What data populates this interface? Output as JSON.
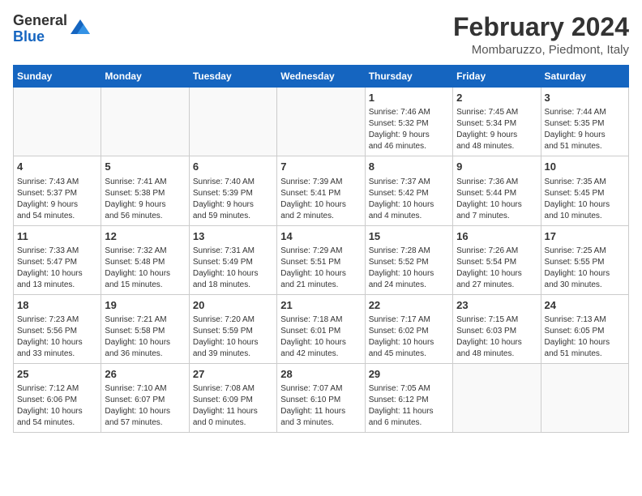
{
  "header": {
    "logo_general": "General",
    "logo_blue": "Blue",
    "title": "February 2024",
    "subtitle": "Mombaruzzo, Piedmont, Italy"
  },
  "days_of_week": [
    "Sunday",
    "Monday",
    "Tuesday",
    "Wednesday",
    "Thursday",
    "Friday",
    "Saturday"
  ],
  "weeks": [
    [
      {
        "day": "",
        "info": ""
      },
      {
        "day": "",
        "info": ""
      },
      {
        "day": "",
        "info": ""
      },
      {
        "day": "",
        "info": ""
      },
      {
        "day": "1",
        "info": "Sunrise: 7:46 AM\nSunset: 5:32 PM\nDaylight: 9 hours\nand 46 minutes."
      },
      {
        "day": "2",
        "info": "Sunrise: 7:45 AM\nSunset: 5:34 PM\nDaylight: 9 hours\nand 48 minutes."
      },
      {
        "day": "3",
        "info": "Sunrise: 7:44 AM\nSunset: 5:35 PM\nDaylight: 9 hours\nand 51 minutes."
      }
    ],
    [
      {
        "day": "4",
        "info": "Sunrise: 7:43 AM\nSunset: 5:37 PM\nDaylight: 9 hours\nand 54 minutes."
      },
      {
        "day": "5",
        "info": "Sunrise: 7:41 AM\nSunset: 5:38 PM\nDaylight: 9 hours\nand 56 minutes."
      },
      {
        "day": "6",
        "info": "Sunrise: 7:40 AM\nSunset: 5:39 PM\nDaylight: 9 hours\nand 59 minutes."
      },
      {
        "day": "7",
        "info": "Sunrise: 7:39 AM\nSunset: 5:41 PM\nDaylight: 10 hours\nand 2 minutes."
      },
      {
        "day": "8",
        "info": "Sunrise: 7:37 AM\nSunset: 5:42 PM\nDaylight: 10 hours\nand 4 minutes."
      },
      {
        "day": "9",
        "info": "Sunrise: 7:36 AM\nSunset: 5:44 PM\nDaylight: 10 hours\nand 7 minutes."
      },
      {
        "day": "10",
        "info": "Sunrise: 7:35 AM\nSunset: 5:45 PM\nDaylight: 10 hours\nand 10 minutes."
      }
    ],
    [
      {
        "day": "11",
        "info": "Sunrise: 7:33 AM\nSunset: 5:47 PM\nDaylight: 10 hours\nand 13 minutes."
      },
      {
        "day": "12",
        "info": "Sunrise: 7:32 AM\nSunset: 5:48 PM\nDaylight: 10 hours\nand 15 minutes."
      },
      {
        "day": "13",
        "info": "Sunrise: 7:31 AM\nSunset: 5:49 PM\nDaylight: 10 hours\nand 18 minutes."
      },
      {
        "day": "14",
        "info": "Sunrise: 7:29 AM\nSunset: 5:51 PM\nDaylight: 10 hours\nand 21 minutes."
      },
      {
        "day": "15",
        "info": "Sunrise: 7:28 AM\nSunset: 5:52 PM\nDaylight: 10 hours\nand 24 minutes."
      },
      {
        "day": "16",
        "info": "Sunrise: 7:26 AM\nSunset: 5:54 PM\nDaylight: 10 hours\nand 27 minutes."
      },
      {
        "day": "17",
        "info": "Sunrise: 7:25 AM\nSunset: 5:55 PM\nDaylight: 10 hours\nand 30 minutes."
      }
    ],
    [
      {
        "day": "18",
        "info": "Sunrise: 7:23 AM\nSunset: 5:56 PM\nDaylight: 10 hours\nand 33 minutes."
      },
      {
        "day": "19",
        "info": "Sunrise: 7:21 AM\nSunset: 5:58 PM\nDaylight: 10 hours\nand 36 minutes."
      },
      {
        "day": "20",
        "info": "Sunrise: 7:20 AM\nSunset: 5:59 PM\nDaylight: 10 hours\nand 39 minutes."
      },
      {
        "day": "21",
        "info": "Sunrise: 7:18 AM\nSunset: 6:01 PM\nDaylight: 10 hours\nand 42 minutes."
      },
      {
        "day": "22",
        "info": "Sunrise: 7:17 AM\nSunset: 6:02 PM\nDaylight: 10 hours\nand 45 minutes."
      },
      {
        "day": "23",
        "info": "Sunrise: 7:15 AM\nSunset: 6:03 PM\nDaylight: 10 hours\nand 48 minutes."
      },
      {
        "day": "24",
        "info": "Sunrise: 7:13 AM\nSunset: 6:05 PM\nDaylight: 10 hours\nand 51 minutes."
      }
    ],
    [
      {
        "day": "25",
        "info": "Sunrise: 7:12 AM\nSunset: 6:06 PM\nDaylight: 10 hours\nand 54 minutes."
      },
      {
        "day": "26",
        "info": "Sunrise: 7:10 AM\nSunset: 6:07 PM\nDaylight: 10 hours\nand 57 minutes."
      },
      {
        "day": "27",
        "info": "Sunrise: 7:08 AM\nSunset: 6:09 PM\nDaylight: 11 hours\nand 0 minutes."
      },
      {
        "day": "28",
        "info": "Sunrise: 7:07 AM\nSunset: 6:10 PM\nDaylight: 11 hours\nand 3 minutes."
      },
      {
        "day": "29",
        "info": "Sunrise: 7:05 AM\nSunset: 6:12 PM\nDaylight: 11 hours\nand 6 minutes."
      },
      {
        "day": "",
        "info": ""
      },
      {
        "day": "",
        "info": ""
      }
    ]
  ]
}
